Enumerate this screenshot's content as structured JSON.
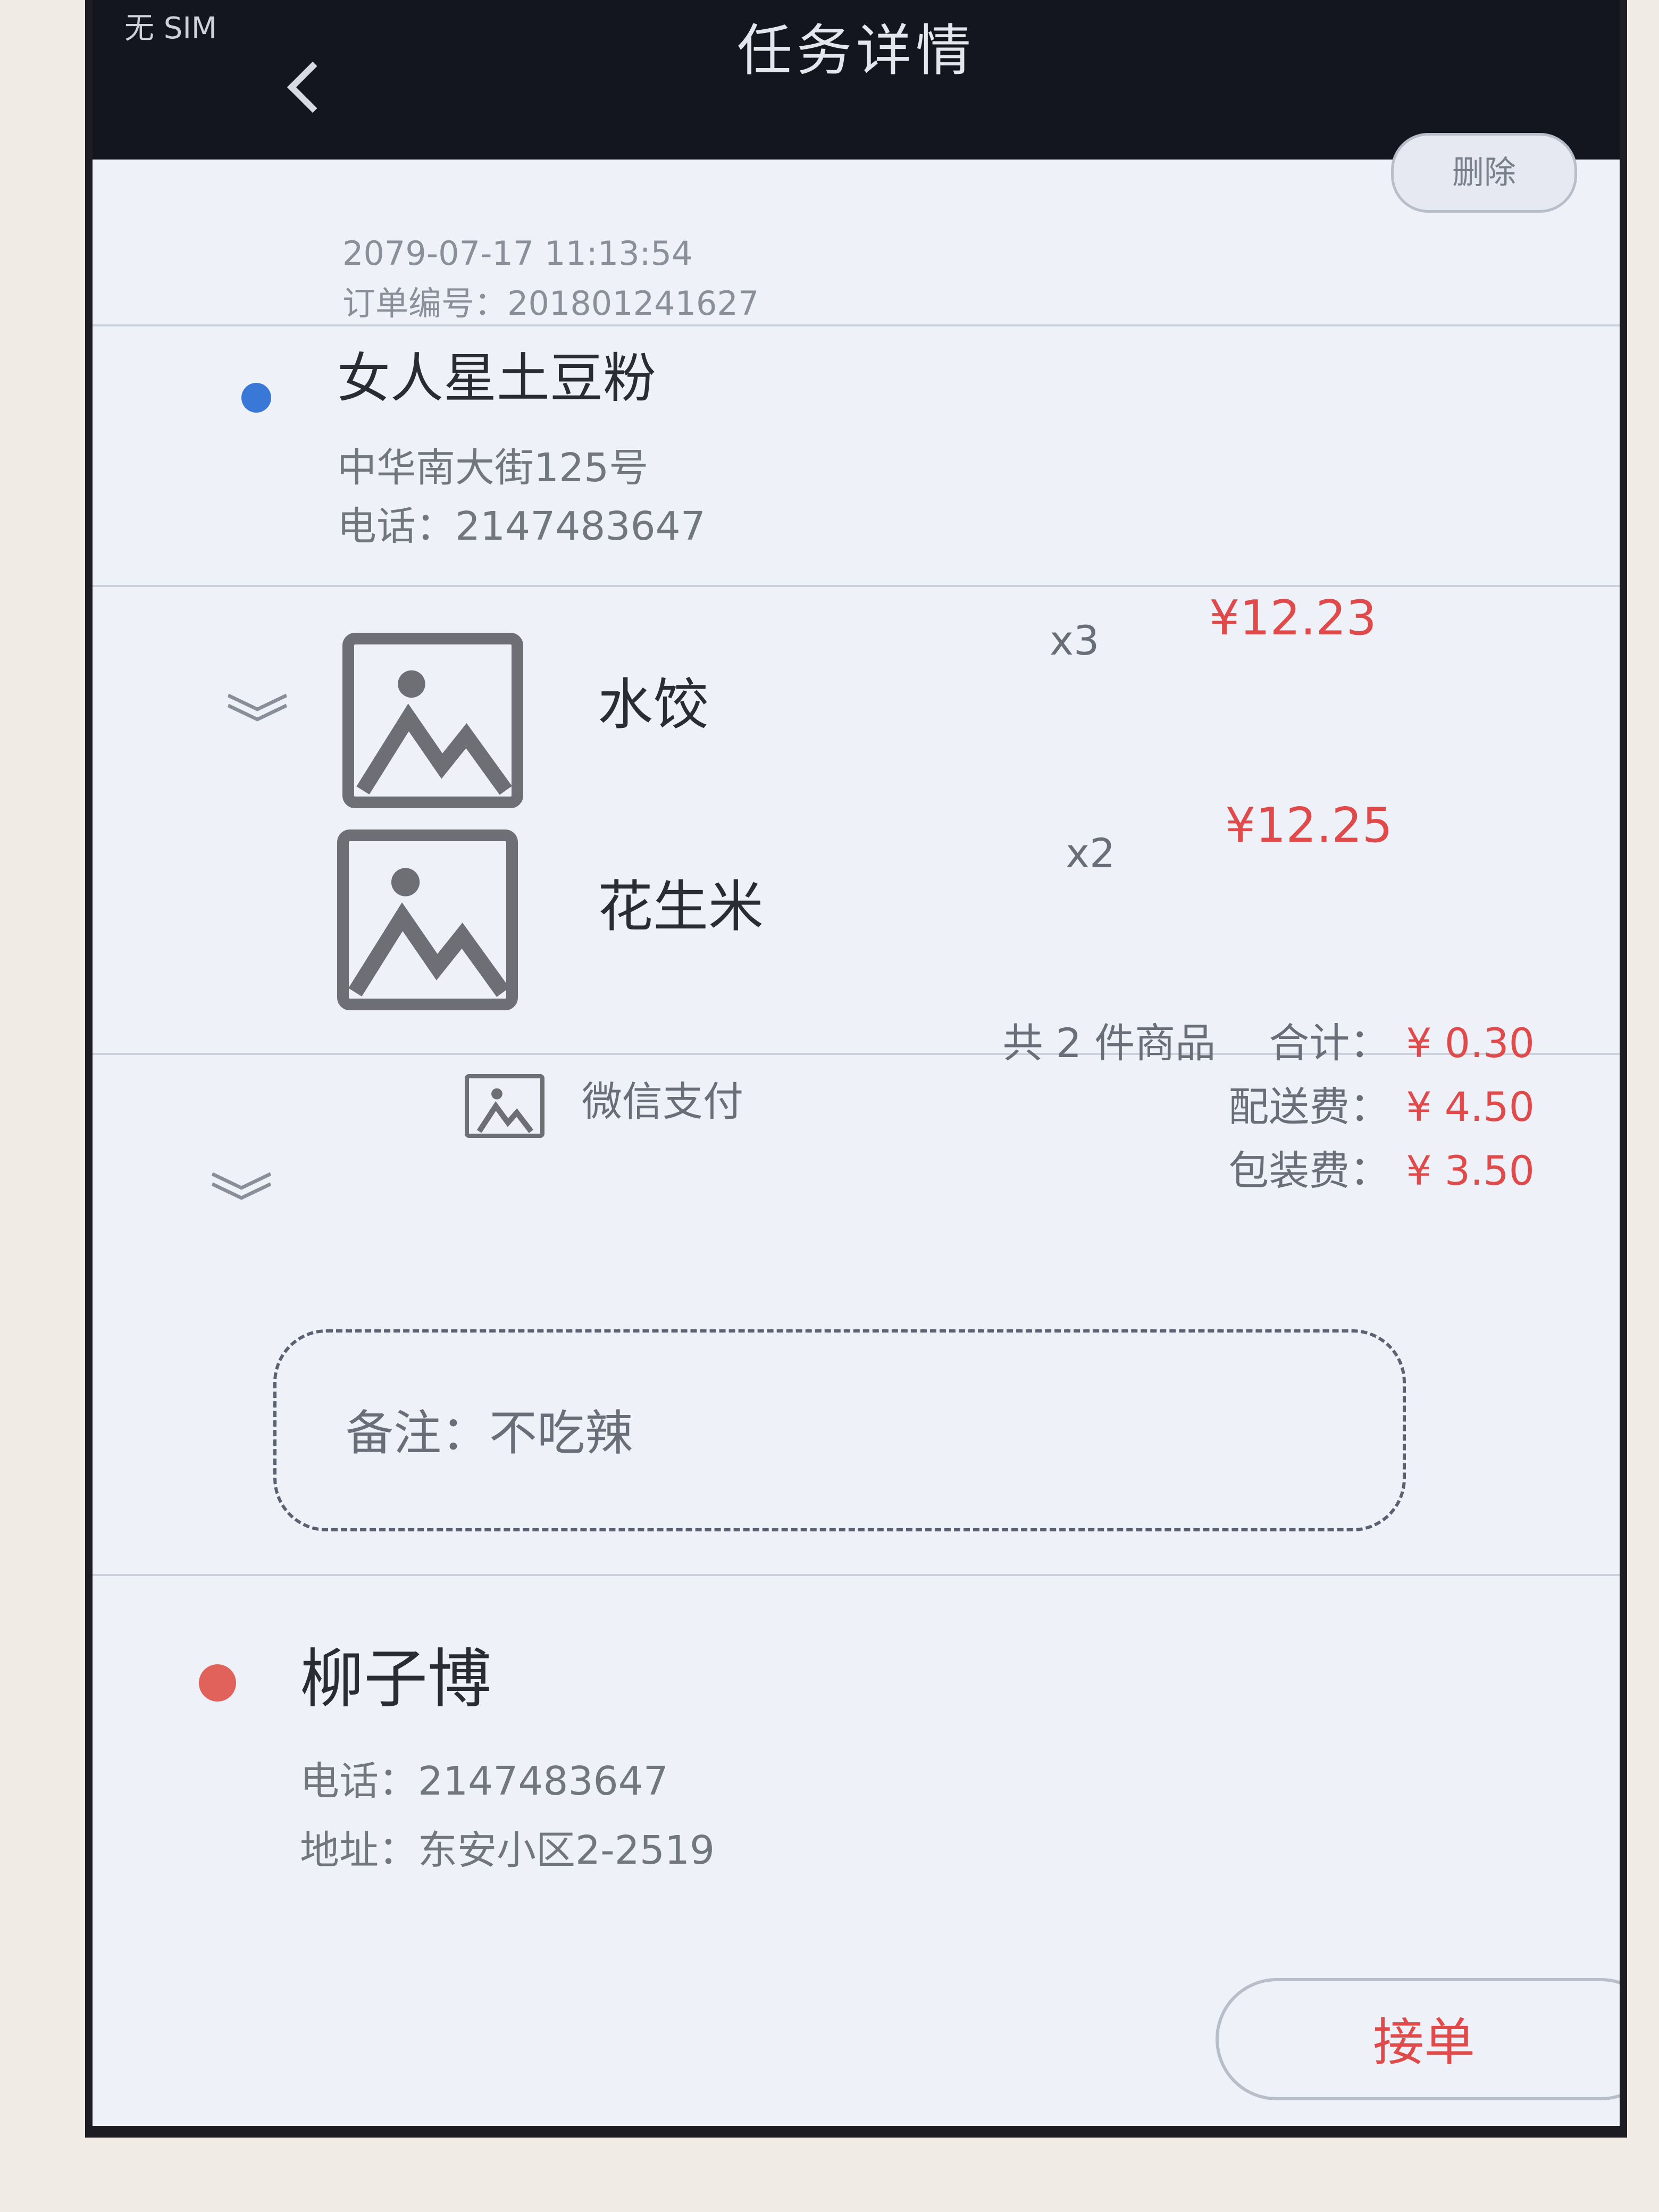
{
  "status_bar": {
    "carrier": "无 SIM"
  },
  "nav": {
    "title": "任务详情"
  },
  "order": {
    "delete_label": "删除",
    "datetime": "2079-07-17 11:13:54",
    "order_number_label": "订单编号：",
    "order_number": "201801241627"
  },
  "shop": {
    "name": "女人星土豆粉",
    "address": "中华南大街125号",
    "phone_label": "电话：",
    "phone": "2147483647"
  },
  "items": [
    {
      "name": "水饺",
      "qty": "x3",
      "price": "¥12.23",
      "image_icon": "image-placeholder-icon"
    },
    {
      "name": "花生米",
      "qty": "x2",
      "price": "¥12.25",
      "image_icon": "image-placeholder-icon"
    }
  ],
  "payment": {
    "method": "微信支付",
    "count_text": "共 2 件商品",
    "total_label": "合计：",
    "total": "¥ 0.30",
    "delivery_label": "配送费：",
    "delivery": "¥ 4.50",
    "packing_label": "包装费：",
    "packing": "¥ 3.50"
  },
  "note": {
    "text": "备注：不吃辣"
  },
  "receiver": {
    "name": "柳子博",
    "phone_label": "电话：",
    "phone": "2147483647",
    "address_label": "地址：",
    "address": "东安小区2-2519"
  },
  "actions": {
    "accept_label": "接单"
  },
  "colors": {
    "accent_red": "#e04a4a",
    "shop_dot": "#3a78d8",
    "receiver_dot": "#e0625a",
    "navbar_bg": "#14161f"
  }
}
